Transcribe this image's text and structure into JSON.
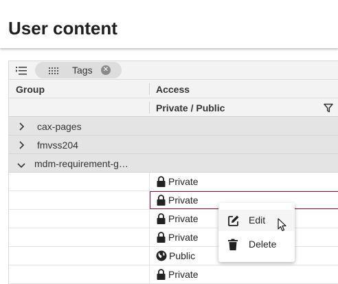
{
  "header": {
    "title": "User content"
  },
  "toolbar": {
    "toggle_icon": "list-indent-icon",
    "tag_chip": {
      "label": "Tags",
      "grip_icon": "drag-grip-icon",
      "remove_icon": "close-circle-icon",
      "remove_glyph": "✕"
    }
  },
  "columns": {
    "group": "Group",
    "access": "Access",
    "access_sub": "Private / Public",
    "filter_icon": "filter-icon"
  },
  "groups": [
    {
      "label": "cax-pages",
      "state": "collapsed"
    },
    {
      "label": "fmvss204",
      "state": "collapsed"
    },
    {
      "label": "mdm-requirement-g…",
      "state": "expanded"
    }
  ],
  "rows": [
    {
      "access": "Private",
      "icon": "lock-icon"
    },
    {
      "access": "Private",
      "icon": "lock-icon",
      "selected": true
    },
    {
      "access": "Private",
      "icon": "lock-icon"
    },
    {
      "access": "Private",
      "icon": "lock-icon"
    },
    {
      "access": "Public",
      "icon": "globe-icon"
    },
    {
      "access": "Private",
      "icon": "lock-icon"
    }
  ],
  "context_menu": {
    "items": [
      {
        "label": "Edit",
        "icon": "edit-icon",
        "hovered": true
      },
      {
        "label": "Delete",
        "icon": "trash-icon"
      }
    ]
  },
  "colors": {
    "selection_border": "#8b1538",
    "group_row_bg": "#e4e4e4",
    "header_bg": "#f3f3f3"
  }
}
